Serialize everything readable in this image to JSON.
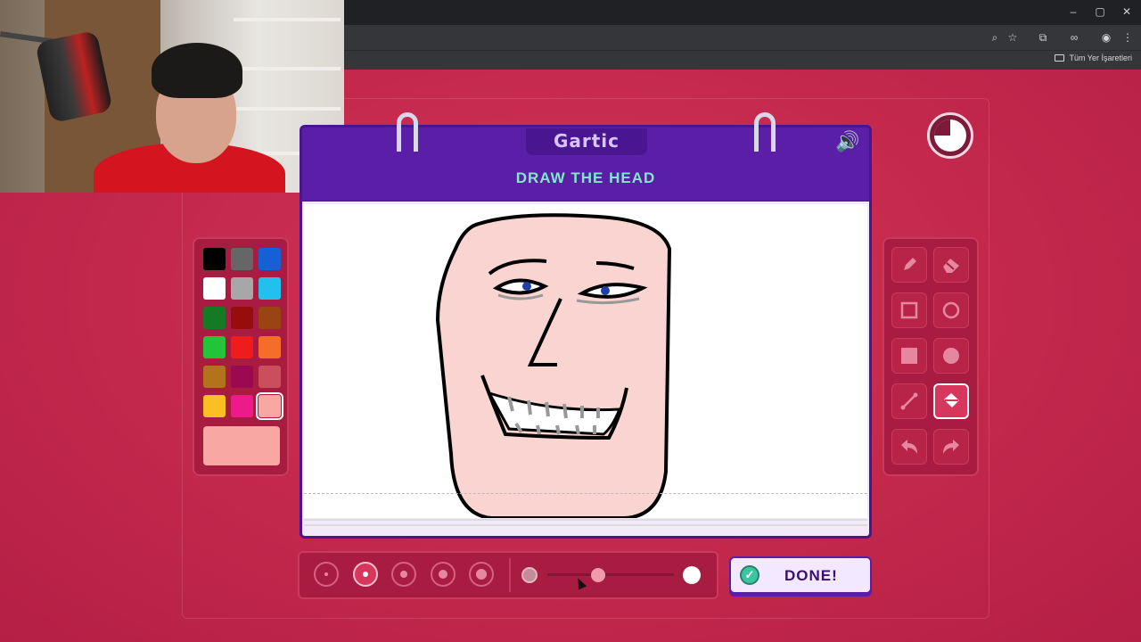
{
  "browser": {
    "bookmarks_folder_label": "Tüm Yer İşaretleri",
    "window_controls": [
      "–",
      "▢",
      "✕"
    ]
  },
  "game": {
    "logo": "Gartic",
    "prompt": "DRAW THE HEAD",
    "done_label": "DONE!",
    "done_icon": "check-icon",
    "sound_icon": "🔊",
    "timer_icon": "timer-icon"
  },
  "palette": {
    "colors": [
      "#000000",
      "#666666",
      "#1560d6",
      "#ffffff",
      "#a7a7a7",
      "#22c0ec",
      "#147b24",
      "#970d0d",
      "#9a4413",
      "#22c43a",
      "#ee1c1c",
      "#f46d29",
      "#b1731b",
      "#9b0a50",
      "#c94f5c",
      "#fbbf23",
      "#ee1a8a",
      "#f9a7a2"
    ],
    "selected_index": 17,
    "current_color": "#f9a7a2"
  },
  "tools": [
    {
      "name": "pencil-icon",
      "active": false
    },
    {
      "name": "eraser-icon",
      "active": false
    },
    {
      "name": "rectangle-outline-icon",
      "active": false
    },
    {
      "name": "circle-outline-icon",
      "active": false
    },
    {
      "name": "rectangle-filled-icon",
      "active": false
    },
    {
      "name": "circle-filled-icon",
      "active": false
    },
    {
      "name": "line-icon",
      "active": false
    },
    {
      "name": "fill-bucket-icon",
      "active": true
    },
    {
      "name": "undo-icon",
      "active": false
    },
    {
      "name": "redo-icon",
      "active": false
    }
  ],
  "brush": {
    "sizes": [
      1,
      2,
      3,
      4,
      5
    ],
    "selected_size": 2,
    "opacity": 0.4
  }
}
